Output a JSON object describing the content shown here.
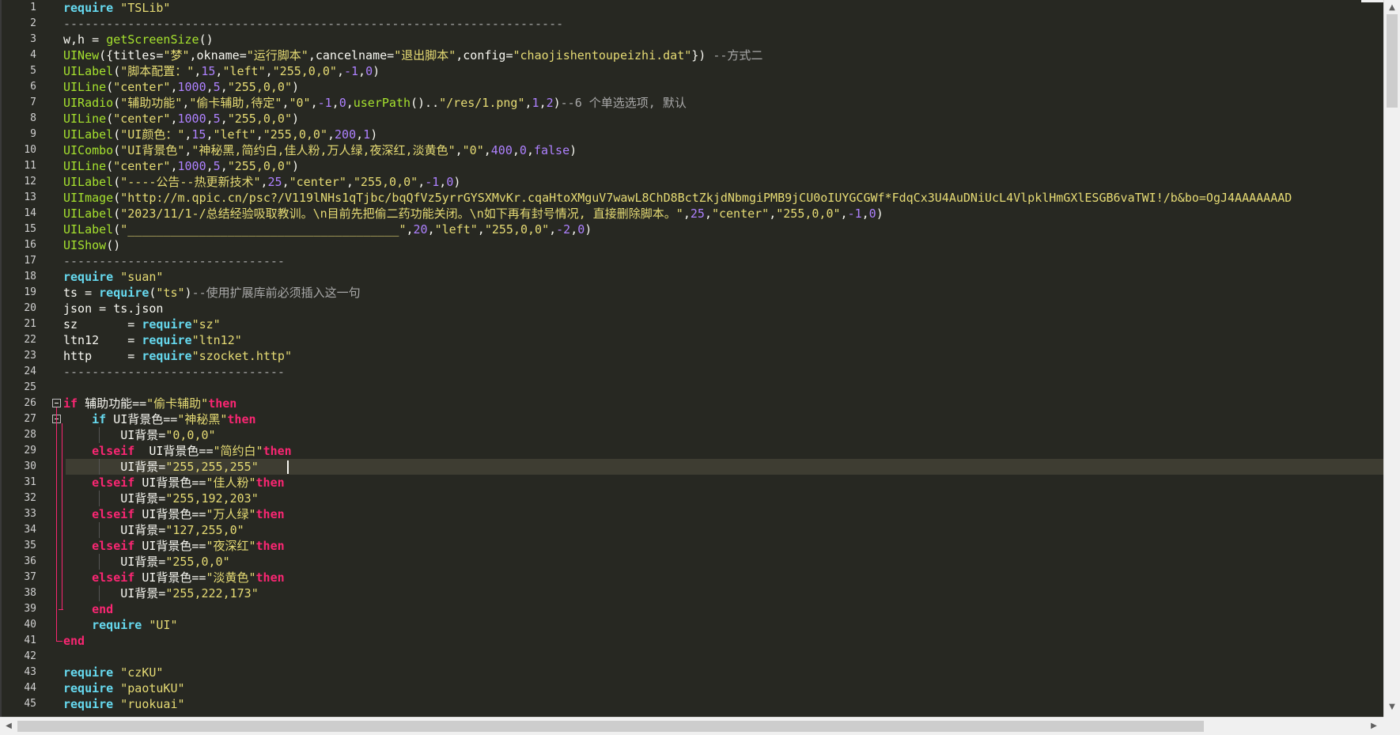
{
  "editor": {
    "current_line": 30,
    "lines": [
      [
        [
          "kw2",
          "require"
        ],
        [
          "str",
          " \"TSLib\""
        ]
      ],
      [
        [
          "cmt",
          "----------------------------------------------------------------------"
        ]
      ],
      [
        [
          "plain",
          "w,h = "
        ],
        [
          "fn",
          "getScreenSize"
        ],
        [
          "plain",
          "()"
        ]
      ],
      [
        [
          "fn",
          "UINew"
        ],
        [
          "plain",
          "({titles="
        ],
        [
          "str",
          "\"梦\""
        ],
        [
          "plain",
          ",okname="
        ],
        [
          "str",
          "\"运行脚本\""
        ],
        [
          "plain",
          ",cancelname="
        ],
        [
          "str",
          "\"退出脚本\""
        ],
        [
          "plain",
          ",config="
        ],
        [
          "str",
          "\"chaojishentoupeizhi.dat\""
        ],
        [
          "plain",
          "}) "
        ],
        [
          "cmt",
          "--方式二"
        ]
      ],
      [
        [
          "fn",
          "UILabel"
        ],
        [
          "plain",
          "("
        ],
        [
          "str",
          "\"脚本配置：\""
        ],
        [
          "plain",
          ","
        ],
        [
          "num",
          "15"
        ],
        [
          "plain",
          ","
        ],
        [
          "str",
          "\"left\""
        ],
        [
          "plain",
          ","
        ],
        [
          "str",
          "\"255,0,0\""
        ],
        [
          "plain",
          ","
        ],
        [
          "num",
          "-1"
        ],
        [
          "plain",
          ","
        ],
        [
          "num",
          "0"
        ],
        [
          "plain",
          ")"
        ]
      ],
      [
        [
          "fn",
          "UILine"
        ],
        [
          "plain",
          "("
        ],
        [
          "str",
          "\"center\""
        ],
        [
          "plain",
          ","
        ],
        [
          "num",
          "1000"
        ],
        [
          "plain",
          ","
        ],
        [
          "num",
          "5"
        ],
        [
          "plain",
          ","
        ],
        [
          "str",
          "\"255,0,0\""
        ],
        [
          "plain",
          ")"
        ]
      ],
      [
        [
          "fn",
          "UIRadio"
        ],
        [
          "plain",
          "("
        ],
        [
          "str",
          "\"辅助功能\""
        ],
        [
          "plain",
          ","
        ],
        [
          "str",
          "\"偷卡辅助,待定\""
        ],
        [
          "plain",
          ","
        ],
        [
          "str",
          "\"0\""
        ],
        [
          "plain",
          ","
        ],
        [
          "num",
          "-1"
        ],
        [
          "plain",
          ","
        ],
        [
          "num",
          "0"
        ],
        [
          "plain",
          ","
        ],
        [
          "fn",
          "userPath"
        ],
        [
          "plain",
          "().."
        ],
        [
          "str",
          "\"/res/1.png\""
        ],
        [
          "plain",
          ","
        ],
        [
          "num",
          "1"
        ],
        [
          "plain",
          ","
        ],
        [
          "num",
          "2"
        ],
        [
          "plain",
          ")"
        ],
        [
          "cmt",
          "--6 个单选选项, 默认"
        ]
      ],
      [
        [
          "fn",
          "UILine"
        ],
        [
          "plain",
          "("
        ],
        [
          "str",
          "\"center\""
        ],
        [
          "plain",
          ","
        ],
        [
          "num",
          "1000"
        ],
        [
          "plain",
          ","
        ],
        [
          "num",
          "5"
        ],
        [
          "plain",
          ","
        ],
        [
          "str",
          "\"255,0,0\""
        ],
        [
          "plain",
          ")"
        ]
      ],
      [
        [
          "fn",
          "UILabel"
        ],
        [
          "plain",
          "("
        ],
        [
          "str",
          "\"UI颜色：\""
        ],
        [
          "plain",
          ","
        ],
        [
          "num",
          "15"
        ],
        [
          "plain",
          ","
        ],
        [
          "str",
          "\"left\""
        ],
        [
          "plain",
          ","
        ],
        [
          "str",
          "\"255,0,0\""
        ],
        [
          "plain",
          ","
        ],
        [
          "num",
          "200"
        ],
        [
          "plain",
          ","
        ],
        [
          "num",
          "1"
        ],
        [
          "plain",
          ")"
        ]
      ],
      [
        [
          "fn",
          "UICombo"
        ],
        [
          "plain",
          "("
        ],
        [
          "str",
          "\"UI背景色\""
        ],
        [
          "plain",
          ","
        ],
        [
          "str",
          "\"神秘黑,简约白,佳人粉,万人绿,夜深红,淡黄色\""
        ],
        [
          "plain",
          ","
        ],
        [
          "str",
          "\"0\""
        ],
        [
          "plain",
          ","
        ],
        [
          "num",
          "400"
        ],
        [
          "plain",
          ","
        ],
        [
          "num",
          "0"
        ],
        [
          "plain",
          ","
        ],
        [
          "num",
          "false"
        ],
        [
          "plain",
          ")"
        ]
      ],
      [
        [
          "fn",
          "UILine"
        ],
        [
          "plain",
          "("
        ],
        [
          "str",
          "\"center\""
        ],
        [
          "plain",
          ","
        ],
        [
          "num",
          "1000"
        ],
        [
          "plain",
          ","
        ],
        [
          "num",
          "5"
        ],
        [
          "plain",
          ","
        ],
        [
          "str",
          "\"255,0,0\""
        ],
        [
          "plain",
          ")"
        ]
      ],
      [
        [
          "fn",
          "UILabel"
        ],
        [
          "plain",
          "("
        ],
        [
          "str",
          "\"----公告--热更新技术\""
        ],
        [
          "plain",
          ","
        ],
        [
          "num",
          "25"
        ],
        [
          "plain",
          ","
        ],
        [
          "str",
          "\"center\""
        ],
        [
          "plain",
          ","
        ],
        [
          "str",
          "\"255,0,0\""
        ],
        [
          "plain",
          ","
        ],
        [
          "num",
          "-1"
        ],
        [
          "plain",
          ","
        ],
        [
          "num",
          "0"
        ],
        [
          "plain",
          ")"
        ]
      ],
      [
        [
          "fn",
          "UIImage"
        ],
        [
          "plain",
          "("
        ],
        [
          "str",
          "\"http://m.qpic.cn/psc?/V119lNHs1qTjbc/bqQfVz5yrrGYSXMvKr.cqaHtoXMguV7wawL8ChD8BctZkjdNbmgiPMB9jCU0oIUYGCGWf*FdqCx3U4AuDNiUcL4VlpklHmGXlESGB6vaTWI!/b&bo=OgJ4AAAAAAAD"
        ]
      ],
      [
        [
          "fn",
          "UILabel"
        ],
        [
          "plain",
          "("
        ],
        [
          "str",
          "\"2023/11/1-/总结经验吸取教训。\\n目前先把偷二药功能关闭。\\n如下再有封号情况, 直接删除脚本。\""
        ],
        [
          "plain",
          ","
        ],
        [
          "num",
          "25"
        ],
        [
          "plain",
          ","
        ],
        [
          "str",
          "\"center\""
        ],
        [
          "plain",
          ","
        ],
        [
          "str",
          "\"255,0,0\""
        ],
        [
          "plain",
          ","
        ],
        [
          "num",
          "-1"
        ],
        [
          "plain",
          ","
        ],
        [
          "num",
          "0"
        ],
        [
          "plain",
          ")"
        ]
      ],
      [
        [
          "fn",
          "UILabel"
        ],
        [
          "plain",
          "("
        ],
        [
          "str",
          "\"______________________________________\""
        ],
        [
          "plain",
          ","
        ],
        [
          "num",
          "20"
        ],
        [
          "plain",
          ","
        ],
        [
          "str",
          "\"left\""
        ],
        [
          "plain",
          ","
        ],
        [
          "str",
          "\"255,0,0\""
        ],
        [
          "plain",
          ","
        ],
        [
          "num",
          "-2"
        ],
        [
          "plain",
          ","
        ],
        [
          "num",
          "0"
        ],
        [
          "plain",
          ")"
        ]
      ],
      [
        [
          "fn",
          "UIShow"
        ],
        [
          "plain",
          "()"
        ]
      ],
      [
        [
          "cmt",
          "-------------------------------"
        ]
      ],
      [
        [
          "kw2",
          "require"
        ],
        [
          "str",
          " \"suan\""
        ]
      ],
      [
        [
          "plain",
          "ts = "
        ],
        [
          "kw2",
          "require"
        ],
        [
          "plain",
          "("
        ],
        [
          "str",
          "\"ts\""
        ],
        [
          "plain",
          ")"
        ],
        [
          "cmt",
          "--使用扩展库前必须插入这一句"
        ]
      ],
      [
        [
          "plain",
          "json = ts.json"
        ]
      ],
      [
        [
          "plain",
          "sz       = "
        ],
        [
          "kw2",
          "require"
        ],
        [
          "str",
          "\"sz\""
        ]
      ],
      [
        [
          "plain",
          "ltn12    = "
        ],
        [
          "kw2",
          "require"
        ],
        [
          "str",
          "\"ltn12\""
        ]
      ],
      [
        [
          "plain",
          "http     = "
        ],
        [
          "kw2",
          "require"
        ],
        [
          "str",
          "\"szocket.http\""
        ]
      ],
      [
        [
          "cmt",
          "-------------------------------"
        ]
      ],
      [],
      [
        [
          "kw",
          "if"
        ],
        [
          "plain",
          " 辅助功能=="
        ],
        [
          "str",
          "\"偷卡辅助\""
        ],
        [
          "kw",
          "then"
        ]
      ],
      [
        [
          "plain",
          "    "
        ],
        [
          "kw2",
          "if"
        ],
        [
          "plain",
          " UI背景色=="
        ],
        [
          "str",
          "\"神秘黑\""
        ],
        [
          "kw",
          "then"
        ]
      ],
      [
        [
          "plain",
          "        UI背景="
        ],
        [
          "str",
          "\"0,0,0\""
        ]
      ],
      [
        [
          "plain",
          "    "
        ],
        [
          "kw",
          "elseif"
        ],
        [
          "plain",
          "  UI背景色=="
        ],
        [
          "str",
          "\"简约白\""
        ],
        [
          "kw",
          "then"
        ]
      ],
      [
        [
          "plain",
          "        UI背景="
        ],
        [
          "str",
          "\"255,255,255\""
        ]
      ],
      [
        [
          "plain",
          "    "
        ],
        [
          "kw",
          "elseif"
        ],
        [
          "plain",
          " UI背景色=="
        ],
        [
          "str",
          "\"佳人粉\""
        ],
        [
          "kw",
          "then"
        ]
      ],
      [
        [
          "plain",
          "        UI背景="
        ],
        [
          "str",
          "\"255,192,203\""
        ]
      ],
      [
        [
          "plain",
          "    "
        ],
        [
          "kw",
          "elseif"
        ],
        [
          "plain",
          " UI背景色=="
        ],
        [
          "str",
          "\"万人绿\""
        ],
        [
          "kw",
          "then"
        ]
      ],
      [
        [
          "plain",
          "        UI背景="
        ],
        [
          "str",
          "\"127,255,0\""
        ]
      ],
      [
        [
          "plain",
          "    "
        ],
        [
          "kw",
          "elseif"
        ],
        [
          "plain",
          " UI背景色=="
        ],
        [
          "str",
          "\"夜深红\""
        ],
        [
          "kw",
          "then"
        ]
      ],
      [
        [
          "plain",
          "        UI背景="
        ],
        [
          "str",
          "\"255,0,0\""
        ]
      ],
      [
        [
          "plain",
          "    "
        ],
        [
          "kw",
          "elseif"
        ],
        [
          "plain",
          " UI背景色=="
        ],
        [
          "str",
          "\"淡黄色\""
        ],
        [
          "kw",
          "then"
        ]
      ],
      [
        [
          "plain",
          "        UI背景="
        ],
        [
          "str",
          "\"255,222,173\""
        ]
      ],
      [
        [
          "plain",
          "    "
        ],
        [
          "kw",
          "end"
        ]
      ],
      [
        [
          "plain",
          "    "
        ],
        [
          "kw2",
          "require"
        ],
        [
          "str",
          " \"UI\""
        ]
      ],
      [
        [
          "kw",
          "end"
        ]
      ],
      [],
      [
        [
          "kw2",
          "require"
        ],
        [
          "str",
          " \"czKU\""
        ]
      ],
      [
        [
          "kw2",
          "require"
        ],
        [
          "str",
          " \"paotuKU\""
        ]
      ],
      [
        [
          "kw2",
          "require"
        ],
        [
          "str",
          " \"ruokuai\""
        ]
      ]
    ]
  },
  "scrollbars": {
    "up_arrow": "▲",
    "down_arrow": "▼",
    "left_arrow": "◀",
    "right_arrow": "▶"
  },
  "colors": {
    "background": "#272822",
    "keyword": "#f92672",
    "builtin": "#66d9ef",
    "function": "#a6e22e",
    "string": "#e6db74",
    "number": "#ae81ff",
    "comment": "#a8a8a8"
  }
}
